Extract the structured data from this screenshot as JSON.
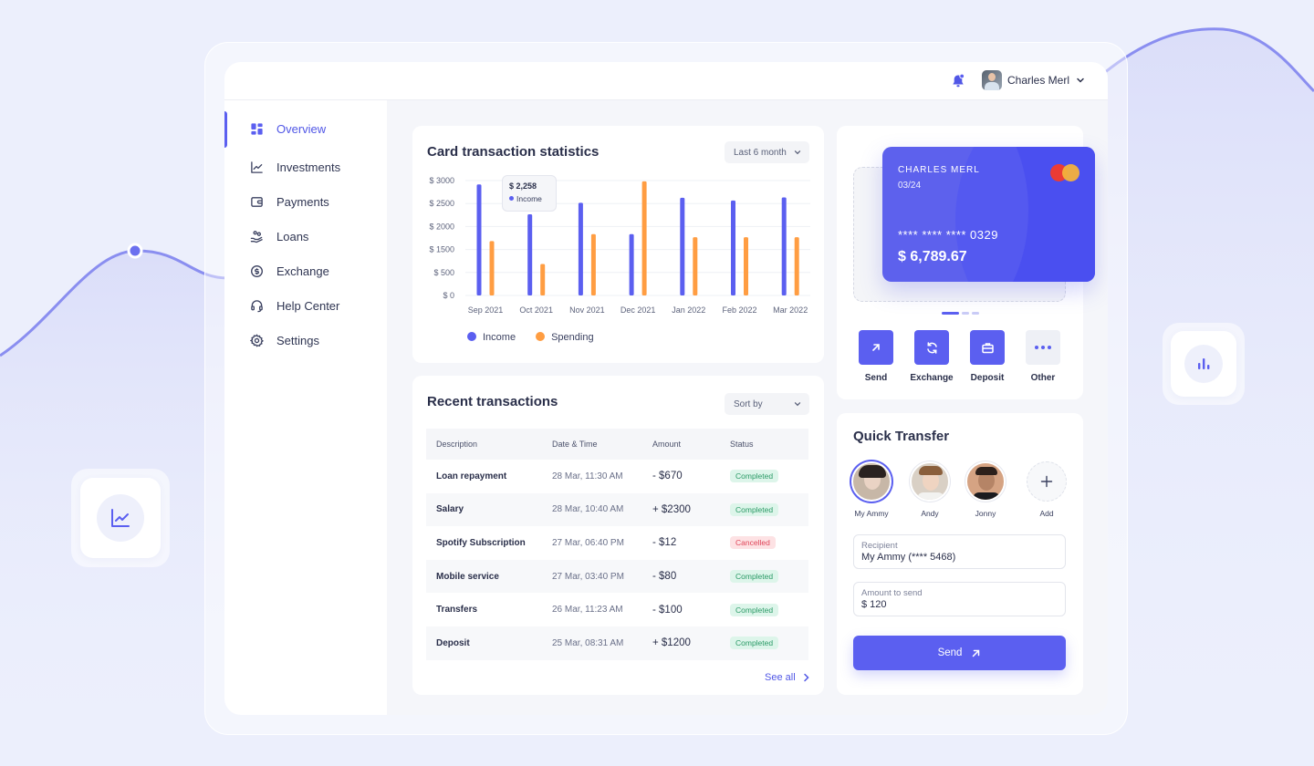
{
  "user": {
    "name": "Charles Merl"
  },
  "nav": [
    {
      "id": "overview",
      "label": "Overview",
      "icon": "dashboard-icon",
      "active": true
    },
    {
      "id": "investments",
      "label": "Investments",
      "icon": "chart-line-icon"
    },
    {
      "id": "payments",
      "label": "Payments",
      "icon": "wallet-icon"
    },
    {
      "id": "loans",
      "label": "Loans",
      "icon": "loan-hand-icon"
    },
    {
      "id": "exchange",
      "label": "Exchange",
      "icon": "exchange-coin-icon"
    },
    {
      "id": "help",
      "label": "Help Center",
      "icon": "headset-icon"
    },
    {
      "id": "settings",
      "label": "Settings",
      "icon": "gear-icon"
    }
  ],
  "stats": {
    "title": "Card transaction statistics",
    "period": "Last 6 month",
    "tooltip": {
      "value": "$ 2,258",
      "label": "Income"
    }
  },
  "chart_data": {
    "type": "bar",
    "categories": [
      "Sep 2021",
      "Oct 2021",
      "Nov 2021",
      "Dec 2021",
      "Jan 2022",
      "Feb 2022",
      "Mar 2022"
    ],
    "series": [
      {
        "name": "Income",
        "color": "#5b5ff0",
        "values": [
          2900,
          2120,
          2420,
          1600,
          2550,
          2480,
          2560
        ]
      },
      {
        "name": "Spending",
        "color": "#ff9d42",
        "values": [
          1420,
          820,
          1600,
          2980,
          1520,
          1520,
          1520
        ]
      }
    ],
    "yticks": [
      "$ 3000",
      "$ 2500",
      "$ 2000",
      "$ 1500",
      "$ 500",
      "$ 0"
    ],
    "ylim": [
      0,
      3000
    ],
    "legend": "bottom-left",
    "grid": true
  },
  "transactions": {
    "title": "Recent transactions",
    "sort_label": "Sort by",
    "headers": [
      "Description",
      "Date & Time",
      "Amount",
      "Status"
    ],
    "rows": [
      {
        "desc": "Loan repayment",
        "date": "28 Mar, 11:30 AM",
        "amount": "- $670",
        "status": "Completed"
      },
      {
        "desc": "Salary",
        "date": "28 Mar, 10:40 AM",
        "amount": "+ $2300",
        "status": "Completed"
      },
      {
        "desc": "Spotify Subscription",
        "date": "27 Mar, 06:40 PM",
        "amount": "- $12",
        "status": "Cancelled"
      },
      {
        "desc": "Mobile service",
        "date": "27 Mar, 03:40 PM",
        "amount": "- $80",
        "status": "Completed"
      },
      {
        "desc": "Transfers",
        "date": "26 Mar, 11:23 AM",
        "amount": "- $100",
        "status": "Completed"
      },
      {
        "desc": "Deposit",
        "date": "25 Mar, 08:31 AM",
        "amount": "+ $1200",
        "status": "Completed"
      }
    ],
    "see_all": "See all"
  },
  "card": {
    "holder": "CHARLES MERL",
    "expiry": "03/24",
    "number": "**** **** **** 0329",
    "balance": "$ 6,789.67"
  },
  "actions": [
    {
      "label": "Send",
      "icon": "arrow-up-right-icon"
    },
    {
      "label": "Exchange",
      "icon": "refresh-icon"
    },
    {
      "label": "Deposit",
      "icon": "briefcase-icon"
    },
    {
      "label": "Other",
      "icon": "more-dots-icon"
    }
  ],
  "quick_transfer": {
    "title": "Quick Transfer",
    "contacts": [
      "My Ammy",
      "Andy",
      "Jonny",
      "Add"
    ],
    "recipient_label": "Recipient",
    "recipient_value": "My Ammy (**** 5468)",
    "amount_label": "Amount to send",
    "amount_value": "$ 120",
    "send_label": "Send"
  }
}
